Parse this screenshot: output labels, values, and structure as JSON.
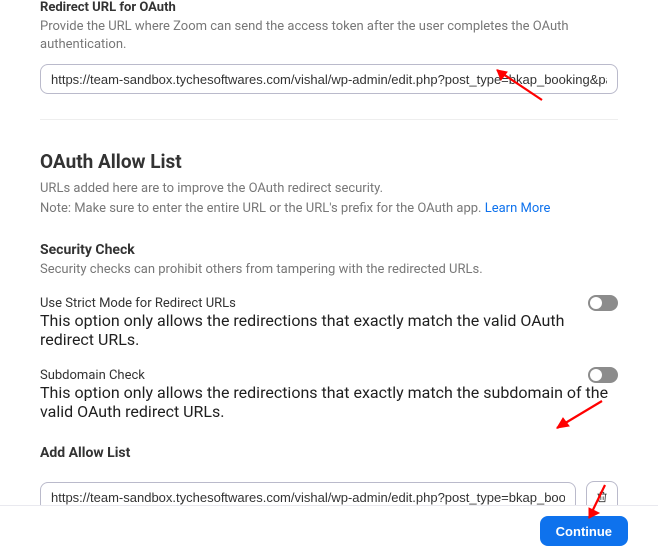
{
  "redirect": {
    "title": "Redirect URL for OAuth",
    "hint": "Provide the URL where Zoom can send the access token after the user completes the OAuth authentication.",
    "value": "https://team-sandbox.tychesoftwares.com/vishal/wp-admin/edit.php?post_type=bkap_booking&page=w"
  },
  "allowlist": {
    "title": "OAuth Allow List",
    "hint_line1": "URLs added here are to improve the OAuth redirect security.",
    "hint_line2_prefix": "Note: Make sure to enter the entire URL or the URL's prefix for the OAuth app. ",
    "learn_more": "Learn More"
  },
  "security_check": {
    "title": "Security Check",
    "hint": "Security checks can prohibit others from tampering with the redirected URLs."
  },
  "strict_mode": {
    "label": "Use Strict Mode for Redirect URLs",
    "hint": "This option only allows the redirections that exactly match the valid OAuth redirect URLs.",
    "enabled": false
  },
  "subdomain_check": {
    "label": "Subdomain Check",
    "hint": "This option only allows the redirections that exactly match the subdomain of the valid OAuth redirect URLs.",
    "enabled": false
  },
  "add_allow_list": {
    "title": "Add Allow List",
    "value": "https://team-sandbox.tychesoftwares.com/vishal/wp-admin/edit.php?post_type=bkap_booking&pa",
    "add_btn_label": "Add Allow List"
  },
  "footer": {
    "continue_label": "Continue"
  }
}
